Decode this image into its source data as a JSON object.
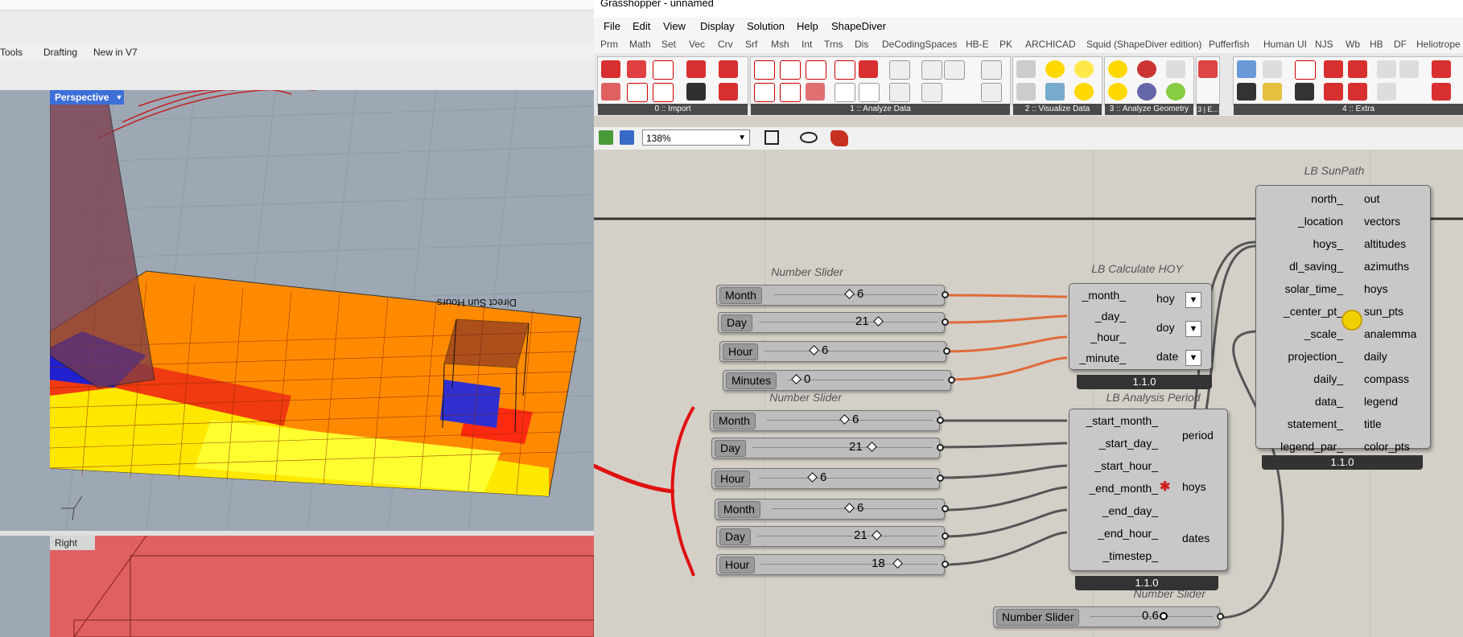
{
  "rhino": {
    "tabs": [
      "Tools",
      "Drafting",
      "New in V7"
    ],
    "viewport_perspective": "Perspective",
    "viewport_right": "Right",
    "scene_text": "Direct Sun Hours"
  },
  "gh": {
    "title": "Grasshopper - unnamed",
    "menu": [
      "File",
      "Edit",
      "View",
      "Display",
      "Solution",
      "Help",
      "ShapeDiver"
    ],
    "categories": [
      "Prm",
      "Math",
      "Set",
      "Vec",
      "Crv",
      "Srf",
      "Msh",
      "Int",
      "Trns",
      "Dis",
      "DeCodingSpaces",
      "HB-E",
      "PK",
      "ARCHICAD",
      "Squid (ShapeDiver edition)",
      "Pufferfish",
      "Human UI",
      "NJS",
      "Wb",
      "HB",
      "DF",
      "Heliotrope"
    ],
    "ribbon_panels": [
      "0 :: Import",
      "1 :: Analyze Data",
      "2 :: Visualize Data",
      "3 :: Analyze Geometry",
      "4 :: Extra"
    ],
    "ribbon_small_label": "3 | E...",
    "zoom": "138%",
    "sunpath": {
      "title": "LB SunPath",
      "inputs": [
        "north_",
        "_location",
        "hoys_",
        "dl_saving_",
        "solar_time_",
        "_center_pt_",
        "_scale_",
        "projection_",
        "daily_",
        "data_",
        "statement_",
        "legend_par_"
      ],
      "outputs": [
        "out",
        "vectors",
        "altitudes",
        "azimuths",
        "hoys",
        "sun_pts",
        "analemma",
        "daily",
        "compass",
        "legend",
        "title",
        "color_pts"
      ],
      "version": "1.1.0"
    },
    "hoy": {
      "title": "LB Calculate HOY",
      "inputs": [
        "_month_",
        "_day_",
        "_hour_",
        "_minute_"
      ],
      "outputs": [
        "hoy",
        "doy",
        "date"
      ],
      "version": "1.1.0"
    },
    "period": {
      "title": "LB Analysis Period",
      "inputs": [
        "_start_month_",
        "_start_day_",
        "_start_hour_",
        "_end_month_",
        "_end_day_",
        "_end_hour_",
        "_timestep_"
      ],
      "outputs": [
        "period",
        "hoys",
        "dates"
      ],
      "version": "1.1.0"
    },
    "slider_group_title_1": "Number Slider",
    "slider_group_title_2": "Number Slider",
    "slider_group_title_3": "Number Slider",
    "sliders_hoy": [
      {
        "label": "Month",
        "value": "6"
      },
      {
        "label": "Day",
        "value": "21"
      },
      {
        "label": "Hour",
        "value": "6"
      },
      {
        "label": "Minutes",
        "value": "0"
      }
    ],
    "sliders_period": [
      {
        "label": "Month",
        "value": "6"
      },
      {
        "label": "Day",
        "value": "21"
      },
      {
        "label": "Hour",
        "value": "6"
      },
      {
        "label": "Month",
        "value": "6"
      },
      {
        "label": "Day",
        "value": "21"
      },
      {
        "label": "Hour",
        "value": "18"
      }
    ],
    "scale_slider": {
      "label": "Number Slider",
      "value": "0.6"
    }
  }
}
